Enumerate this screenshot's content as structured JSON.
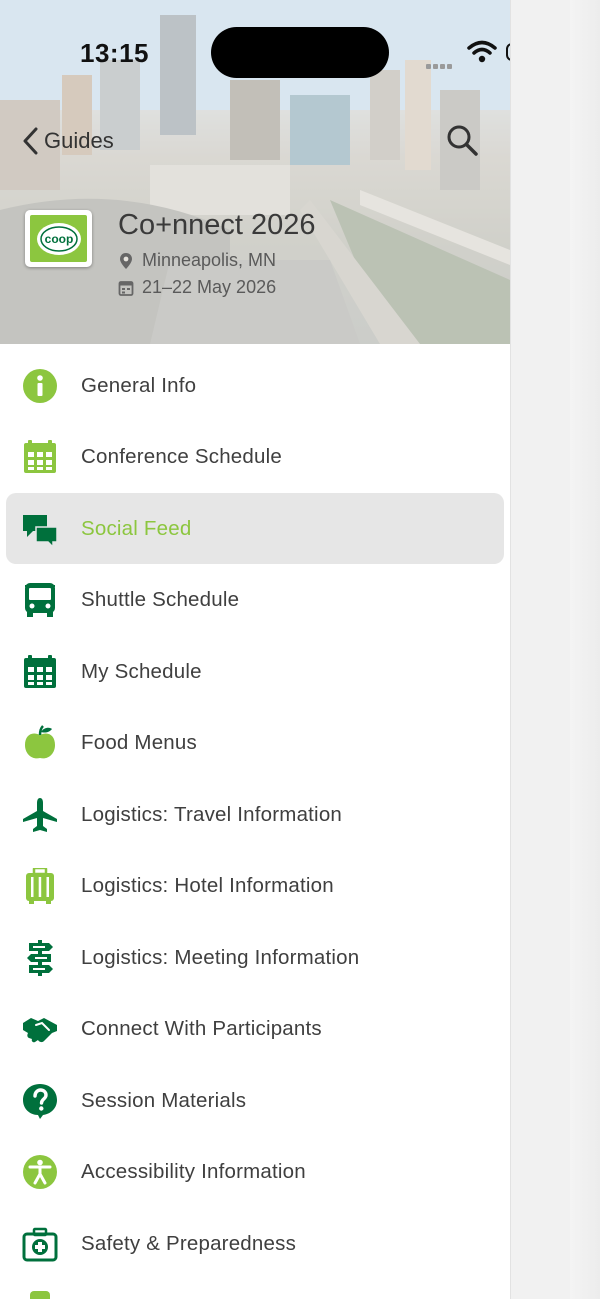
{
  "status_bar": {
    "time": "13:15"
  },
  "nav": {
    "back_label": "Guides",
    "back_icon": "chevron-left-icon",
    "search_icon": "magnifier-icon"
  },
  "event": {
    "title": "Co+nnect 2026",
    "location": "Minneapolis, MN",
    "dates": "21–22 May 2026",
    "logo_text": "coop"
  },
  "colors": {
    "brand_green": "#8cc63f",
    "dark_green": "#00703c",
    "active_bg": "#e6e6e6"
  },
  "menu": [
    {
      "label": "General Info",
      "icon": "info-icon"
    },
    {
      "label": "Conference Schedule",
      "icon": "calendar-icon"
    },
    {
      "label": "Social Feed",
      "icon": "chat-bubbles-icon",
      "active": true
    },
    {
      "label": "Shuttle Schedule",
      "icon": "bus-icon"
    },
    {
      "label": "My Schedule",
      "icon": "calendar-icon"
    },
    {
      "label": "Food Menus",
      "icon": "apple-icon"
    },
    {
      "label": "Logistics: Travel Information",
      "icon": "airplane-icon"
    },
    {
      "label": "Logistics: Hotel Information",
      "icon": "luggage-icon"
    },
    {
      "label": "Logistics: Meeting Information",
      "icon": "signpost-icon"
    },
    {
      "label": "Connect With Participants",
      "icon": "handshake-icon"
    },
    {
      "label": "Session Materials",
      "icon": "question-bubble-icon"
    },
    {
      "label": "Accessibility Information",
      "icon": "accessibility-icon"
    },
    {
      "label": "Safety & Preparedness",
      "icon": "first-aid-kit-icon"
    }
  ]
}
